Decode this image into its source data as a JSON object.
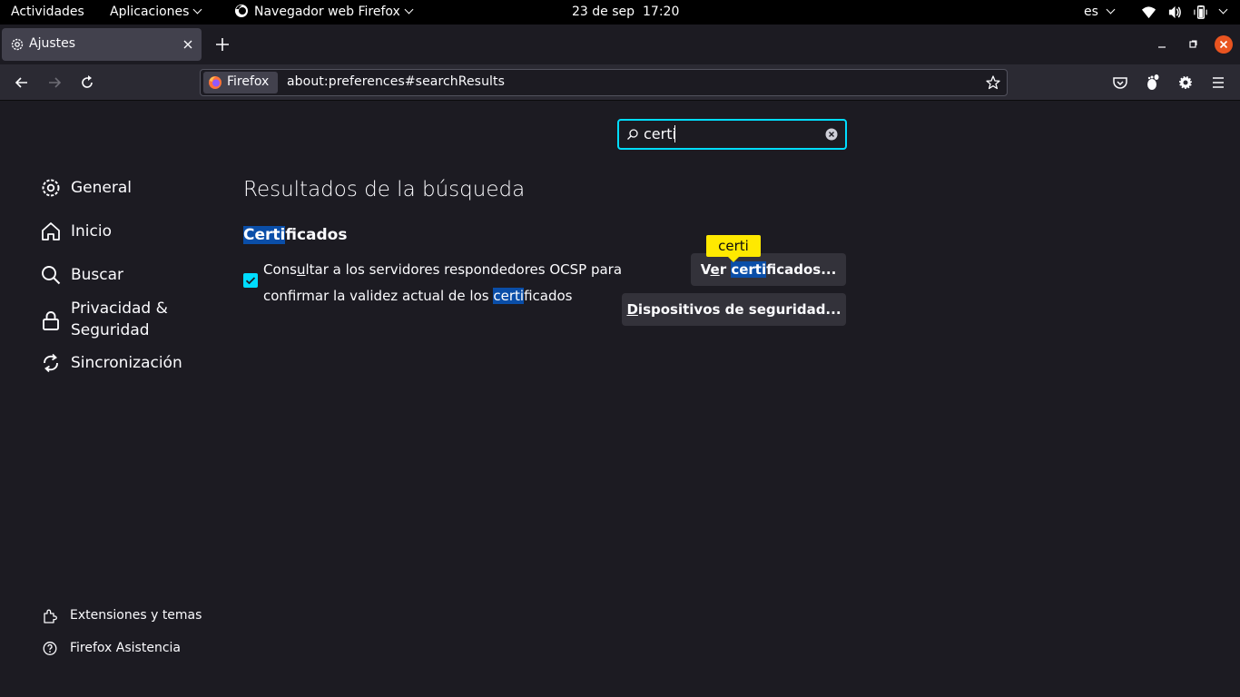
{
  "system_bar": {
    "activities": "Actividades",
    "applications": "Aplicaciones",
    "app_name": "Navegador web Firefox",
    "date": "23 de sep",
    "time": "17:20",
    "language": "es"
  },
  "tab": {
    "title": "Ajustes"
  },
  "urlbar": {
    "identity_label": "Firefox",
    "url": "about:preferences#searchResults"
  },
  "search": {
    "value": "certi"
  },
  "sidebar": {
    "items": [
      {
        "label": "General",
        "icon": "gear-icon"
      },
      {
        "label": "Inicio",
        "icon": "home-icon"
      },
      {
        "label": "Buscar",
        "icon": "search-icon"
      },
      {
        "label": "Privacidad & Seguridad",
        "label_line1": "Privacidad &",
        "label_line2": "Seguridad",
        "icon": "lock-icon"
      },
      {
        "label": "Sincronización",
        "icon": "sync-icon"
      }
    ],
    "footer": [
      {
        "label": "Extensiones y temas",
        "icon": "puzzle-icon"
      },
      {
        "label": "Firefox Asistencia",
        "icon": "help-icon"
      }
    ]
  },
  "main": {
    "results_title": "Resultados de la búsqueda",
    "section": {
      "title_highlight": "Certi",
      "title_rest": "ficados"
    },
    "ocsp": {
      "checked": true,
      "text_before": "Cons",
      "text_underlined": "u",
      "text_mid": "ltar a los servidores respondedores OCSP para confirmar la validez actual de los ",
      "text_highlight": "certi",
      "text_end": "ficados"
    },
    "tooltip": "certi",
    "view_certs_button": {
      "prefix": "V",
      "underlined": "e",
      "mid": "r ",
      "highlight": "certi",
      "suffix": "ficados..."
    },
    "devices_button": {
      "underlined": "D",
      "rest": "ispositivos de seguridad..."
    }
  },
  "colors": {
    "background": "#1c1b22",
    "accent": "#00ddff",
    "highlight": "#0a4ea8",
    "tooltip": "#ffe900",
    "close_button": "#e95420"
  }
}
